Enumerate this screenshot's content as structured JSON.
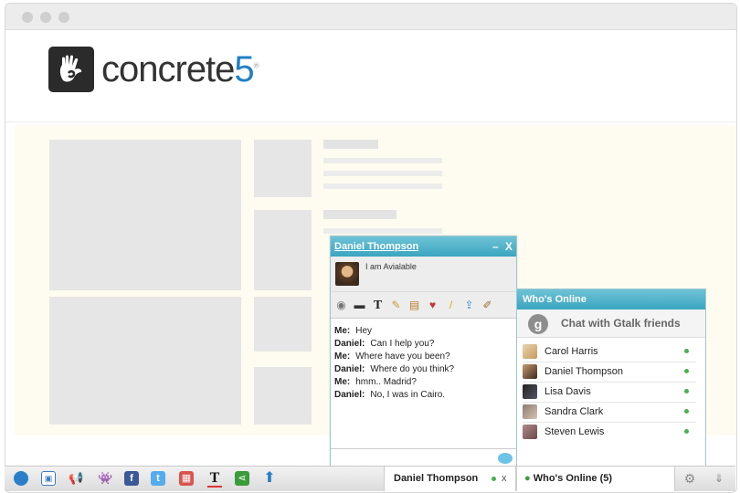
{
  "logo": {
    "text": "concrete",
    "digit": "5",
    "tm": "®"
  },
  "chat": {
    "contact_name": "Daniel Thompson",
    "status_message": "I am Avialable",
    "controls": {
      "minimize": "–",
      "close": "X"
    },
    "messages": [
      {
        "sender": "Me:",
        "text": "Hey"
      },
      {
        "sender": "Daniel:",
        "text": "Can I help you?"
      },
      {
        "sender": "Me:",
        "text": "Where have you been?"
      },
      {
        "sender": "Daniel:",
        "text": "Where do you think?"
      },
      {
        "sender": "Me:",
        "text": "hmm.. Madrid?"
      },
      {
        "sender": "Daniel:",
        "text": "No, I was in Cairo."
      }
    ]
  },
  "online": {
    "title": "Who's Online",
    "gtalk_label": "Chat with Gtalk friends",
    "gtalk_letter": "g",
    "friends": [
      {
        "name": "Carol Harris"
      },
      {
        "name": "Daniel Thompson"
      },
      {
        "name": "Lisa Davis"
      },
      {
        "name": "Sandra Clark"
      },
      {
        "name": "Steven Lewis"
      }
    ]
  },
  "bottom_bar": {
    "chat_tab": {
      "name": "Daniel Thompson",
      "close": "x"
    },
    "online_tab": {
      "label": "Who's Online (5)"
    }
  }
}
